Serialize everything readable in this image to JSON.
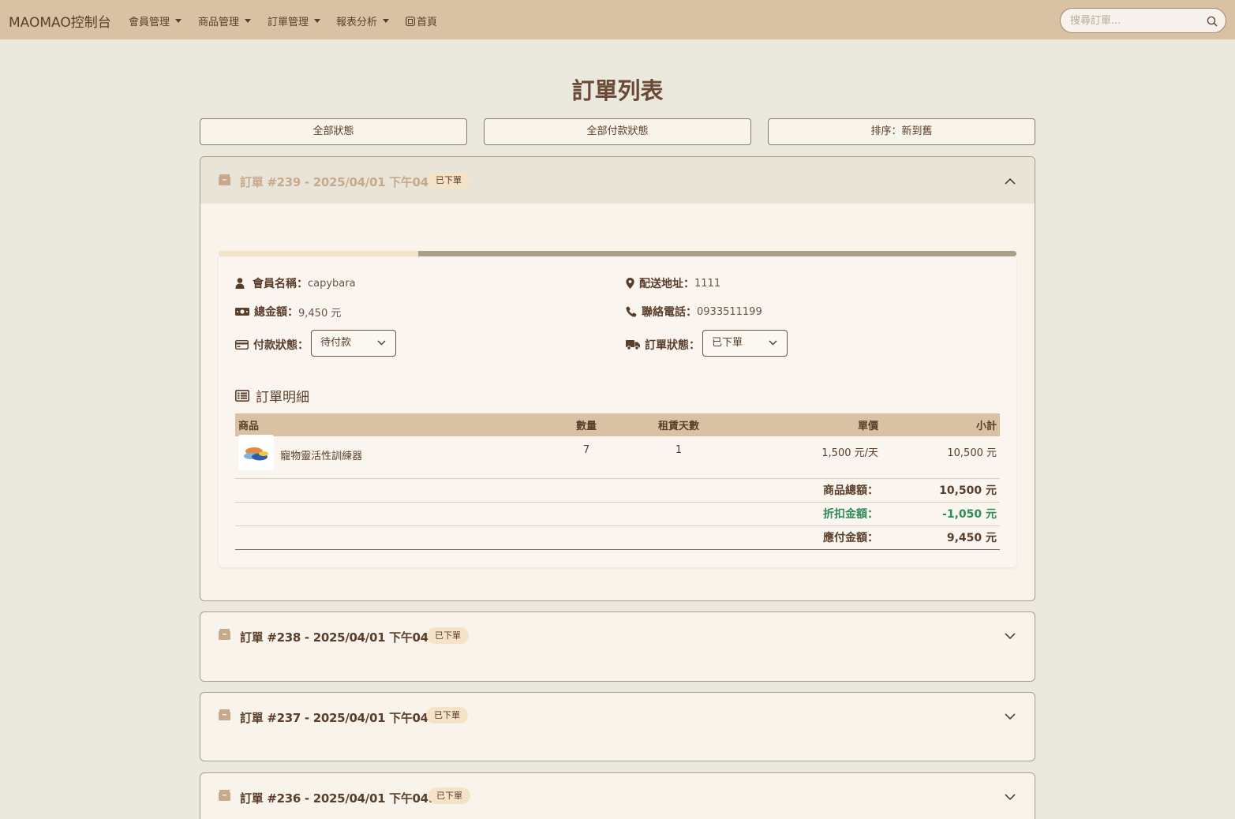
{
  "nav": {
    "brand": "MAOMAO控制台",
    "items": [
      {
        "label": "會員管理"
      },
      {
        "label": "商品管理"
      },
      {
        "label": "訂單管理"
      },
      {
        "label": "報表分析"
      }
    ],
    "home_label": "首頁",
    "search_placeholder": "搜尋訂單..."
  },
  "page_title": "訂單列表",
  "filters": {
    "status": "全部狀態",
    "payment_status": "全部付款狀態",
    "sort": "排序：新到舊"
  },
  "orders": [
    {
      "title": "訂單 #239 - 2025/04/01 下午04:11",
      "badge": "已下單",
      "expanded": true,
      "progress": 0.25,
      "member_label": "會員名稱：",
      "member": "capybara",
      "total_label": "總金額：",
      "total": "9,450 元",
      "payment_label": "付款狀態：",
      "payment_status": "待付款",
      "address_label": "配送地址：",
      "address": "1111",
      "phone_label": "聯絡電話：",
      "phone": "0933511199",
      "order_status_label": "訂單狀態：",
      "order_status": "已下單",
      "detail_title": "訂單明細",
      "columns": {
        "product": "商品",
        "qty": "數量",
        "days": "租賃天數",
        "price": "單價",
        "subtotal": "小計"
      },
      "items": [
        {
          "name": "寵物靈活性訓練器",
          "qty": "7",
          "days": "1",
          "price": "1,500 元/天",
          "subtotal": "10,500 元"
        }
      ],
      "summary": {
        "goods_total_label": "商品總額：",
        "goods_total": "10,500 元",
        "discount_label": "折扣金額：",
        "discount": "-1,050 元",
        "payable_label": "應付金額：",
        "payable": "9,450 元"
      }
    },
    {
      "title": "訂單 #238 - 2025/04/01 下午04:11",
      "badge": "已下單",
      "expanded": false
    },
    {
      "title": "訂單 #237 - 2025/04/01 下午04:11",
      "badge": "已下單",
      "expanded": false
    },
    {
      "title": "訂單 #236 - 2025/04/01 下午04:10",
      "badge": "已下單",
      "expanded": false
    }
  ],
  "colors": {
    "navbar": "#d9c2a3",
    "background": "#ebe8de",
    "text": "#5a3e2b",
    "discount": "#2e8b57",
    "badge": "#f5e3c8"
  }
}
